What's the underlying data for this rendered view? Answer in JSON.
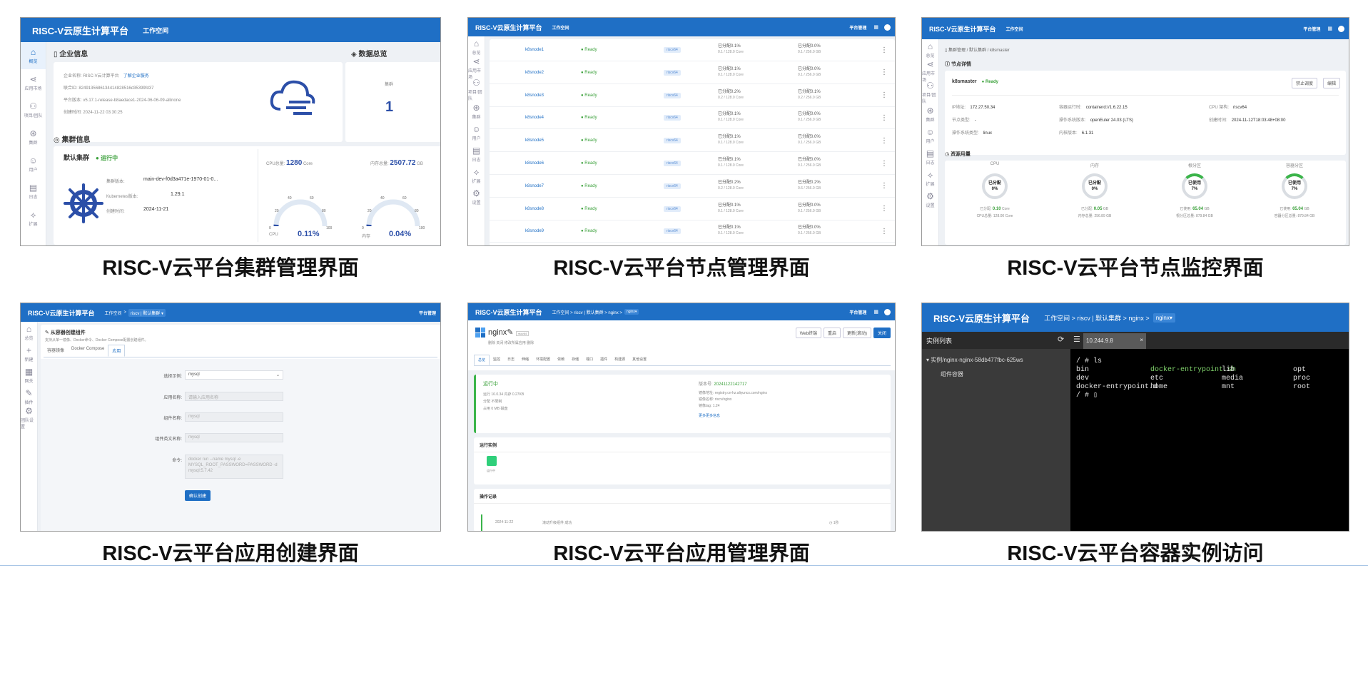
{
  "captions": [
    "RISC-V云平台集群管理界面",
    "RISC-V云平台节点管理界面",
    "RISC-V云平台节点监控界面",
    "RISC-V云平台应用创建界面",
    "RISC-V云平台应用管理界面",
    "RISC-V云平台容器实例访问"
  ],
  "colors": {
    "brand": "#1f6fc5",
    "status_green": "#3aa03a",
    "terminal_bg": "#000000"
  },
  "common": {
    "brand": "RISC-V云原生计算平台",
    "workspace": "工作空间",
    "platform_mgmt": "平台管理"
  },
  "p1": {
    "side": [
      {
        "icon": "home-icon",
        "label": "概览"
      },
      {
        "icon": "share-icon",
        "label": "应用市场"
      },
      {
        "icon": "team-icon",
        "label": "项目/团队"
      },
      {
        "icon": "cluster-icon",
        "label": "集群"
      },
      {
        "icon": "user-icon",
        "label": "用户"
      },
      {
        "icon": "log-icon",
        "label": "日志"
      },
      {
        "icon": "extend-icon",
        "label": "扩展"
      }
    ],
    "ent_title": "企业信息",
    "ent_name": "企业名称: RISC-V云计算平台",
    "ent_link": "了解企业服务",
    "ent_id": "联合ID: 8249135686134414828516d35399fd37",
    "ent_ver": "平台版本: v5.17.1-release-b8aedace1-2024-06-06-09-allinone",
    "ent_time": "创建时间: 2024-11-22 03:30:25",
    "data_title": "数据总览",
    "cluster_label": "集群",
    "cluster_count": "1",
    "cl_title": "集群信息",
    "cl_name": "默认集群",
    "cl_status": "运行中",
    "cl_ver_label": "集群版本:",
    "cl_ver": "main-dev-f0d3a471e-1970-01-0...",
    "k8s_label": "Kubernetes版本:",
    "k8s": "1.29.1",
    "created_label": "创建时间:",
    "created": "2024-11-21",
    "cpu_total_label": "CPU总量:",
    "cpu_total": "1280",
    "cpu_unit": "Core",
    "mem_total_label": "内存总量:",
    "mem_total": "2507.72",
    "mem_unit": "GB",
    "gauge_ticks": [
      "20",
      "40",
      "60",
      "80",
      "100",
      "0"
    ],
    "cpu_label": "CPU",
    "cpu_pct": "0.11%",
    "mem_label": "内存",
    "mem_pct": "0.04%",
    "cpu_level": 0.0011,
    "mem_level": 0.0004
  },
  "p2": {
    "side": [
      {
        "icon": "home-icon",
        "label": "总览"
      },
      {
        "icon": "share-icon",
        "label": "应用市场"
      },
      {
        "icon": "team-icon",
        "label": "项目/团队"
      },
      {
        "icon": "cluster-icon",
        "label": "集群"
      },
      {
        "icon": "user-icon",
        "label": "用户"
      },
      {
        "icon": "log-icon",
        "label": "日志"
      },
      {
        "icon": "extend-icon",
        "label": "扩展"
      },
      {
        "icon": "gear-icon",
        "label": "设置"
      }
    ],
    "rows": [
      {
        "name": "k8snode1",
        "status": "Ready",
        "tag": "riscv64",
        "cpu": "已分配0.1%",
        "cpu2": "0.1 / 128.0 Core",
        "mem": "已分配0.0%",
        "mem2": "0.1 / 256.0 GB"
      },
      {
        "name": "k8snode2",
        "status": "Ready",
        "tag": "riscv64",
        "cpu": "已分配0.1%",
        "cpu2": "0.1 / 128.0 Core",
        "mem": "已分配0.0%",
        "mem2": "0.1 / 256.0 GB"
      },
      {
        "name": "k8snode3",
        "status": "Ready",
        "tag": "riscv64",
        "cpu": "已分配0.2%",
        "cpu2": "0.2 / 128.0 Core",
        "mem": "已分配0.1%",
        "mem2": "0.2 / 256.0 GB"
      },
      {
        "name": "k8snode4",
        "status": "Ready",
        "tag": "riscv64",
        "cpu": "已分配0.1%",
        "cpu2": "0.1 / 128.0 Core",
        "mem": "已分配0.0%",
        "mem2": "0.1 / 256.0 GB"
      },
      {
        "name": "k8snode5",
        "status": "Ready",
        "tag": "riscv64",
        "cpu": "已分配0.1%",
        "cpu2": "0.1 / 128.0 Core",
        "mem": "已分配0.0%",
        "mem2": "0.1 / 256.0 GB"
      },
      {
        "name": "k8snode6",
        "status": "Ready",
        "tag": "riscv64",
        "cpu": "已分配0.1%",
        "cpu2": "0.1 / 128.0 Core",
        "mem": "已分配0.0%",
        "mem2": "0.1 / 256.0 GB"
      },
      {
        "name": "k8snode7",
        "status": "Ready",
        "tag": "riscv64",
        "cpu": "已分配0.2%",
        "cpu2": "0.2 / 128.0 Core",
        "mem": "已分配0.2%",
        "mem2": "0.6 / 256.0 GB"
      },
      {
        "name": "k8snode8",
        "status": "Ready",
        "tag": "riscv64",
        "cpu": "已分配0.1%",
        "cpu2": "0.1 / 128.0 Core",
        "mem": "已分配0.0%",
        "mem2": "0.1 / 256.0 GB"
      },
      {
        "name": "k8snode9",
        "status": "Ready",
        "tag": "riscv64",
        "cpu": "已分配0.1%",
        "cpu2": "0.1 / 128.0 Core",
        "mem": "已分配0.0%",
        "mem2": "0.1 / 256.0 GB"
      }
    ]
  },
  "p3": {
    "breadcrumb": "集群管理 / 默认集群 / k8smaster",
    "detail_title": "节点详情",
    "node": "k8smaster",
    "status": "Ready",
    "btn1": "禁止调度",
    "btn2": "编辑",
    "ip_label": "IP地址:",
    "ip": "172.27.50.34",
    "rt_label": "容器运行时:",
    "rt": "containerd://1.6.22.15",
    "arch_label": "CPU 架构:",
    "arch": "riscv64",
    "type_label": "节点类型:",
    "type": "-",
    "osimg_label": "操作系统版本:",
    "osimg": "openEuler 24.03 (LTS)",
    "ctime_label": "创建时间:",
    "ctime": "2024-11-12T18:03:48+08:00",
    "os_label": "操作系统类型:",
    "os": "linux",
    "kernel_label": "内核版本:",
    "kernel": "6.1.31",
    "usage_title": "资源用量",
    "rings": [
      {
        "title": "CPU",
        "state": "已分配",
        "pct": "0%",
        "l1": "已分配:",
        "v1": "0.10",
        "u1": "Core",
        "l2": "CPU总量:",
        "v2": "128.00 Core",
        "on": false
      },
      {
        "title": "内存",
        "state": "已分配",
        "pct": "0%",
        "l1": "已分配:",
        "v1": "0.05",
        "u1": "GB",
        "l2": "内存总量:",
        "v2": "256.89 GB",
        "on": false
      },
      {
        "title": "根分区",
        "state": "已使用",
        "pct": "7%",
        "l1": "已使用:",
        "v1": "65.04",
        "u1": "GB",
        "l2": "根分区总量:",
        "v2": "879.84 GB",
        "on": true
      },
      {
        "title": "容器分区",
        "state": "已使用",
        "pct": "7%",
        "l1": "已使用:",
        "v1": "65.04",
        "u1": "GB",
        "l2": "容器分区总量:",
        "v2": "879.84 GB",
        "on": true
      }
    ]
  },
  "p4": {
    "crumb": [
      "工作空间",
      ">",
      "riscv | 默认集群"
    ],
    "side": [
      {
        "icon": "home-icon",
        "label": "总览"
      },
      {
        "icon": "plus-icon",
        "label": "新建"
      },
      {
        "icon": "grid-icon",
        "label": "网关"
      },
      {
        "icon": "pen-icon",
        "label": "插件"
      },
      {
        "icon": "gear-icon",
        "label": "团队设置"
      }
    ],
    "title": "从容器创建组件",
    "subtitle": "支持从单一镜像、Docker命令、Docker Compose配置创建组件。",
    "tabs": [
      "容器镜像",
      "Docker Compose",
      "应用"
    ],
    "f1_label": "选择示例:",
    "f1": "mysql",
    "f2_label": "应用名称:",
    "f2": "请输入应用名称",
    "f3_label": "组件名称:",
    "f3": "mysql",
    "f4_label": "组件英文名称:",
    "f4": "mysql",
    "f5_label": "命令:",
    "f5": "docker run --name mysql -e MYSQL_ROOT_PASSWORD=PASSWORD -d mysql:5.7.42",
    "submit": "确认创建"
  },
  "p5": {
    "crumb": "工作空间 > riscv | 默认集群 > nginx >",
    "crumb_tag": "nginx",
    "app": "nginx",
    "app_tag": "riscv64",
    "sub": "删除   关闭   修改所属应用   删除",
    "btns": [
      "Web终端",
      "重启",
      "更新(滚动)",
      "关闭"
    ],
    "tabs": [
      "总览",
      "监控",
      "日志",
      "伸缩",
      "环境配置",
      "依赖",
      "存储",
      "端口",
      "插件",
      "构建源",
      "其他设置"
    ],
    "status": "运行中",
    "l1": "运行 16.0.34 内存 0.27KB",
    "l2": "分配 不限制",
    "l3": "占用 0     MB 磁盘",
    "ver_label": "版本号:",
    "ver": "20241122142717",
    "i1": "镜像地址: registry.cn-hz.aliyuncs.com/nginx",
    "i2": "镜像名称: riscv/nginx",
    "i3": "镜像tag: 1.24",
    "more": "更多更多信息",
    "inst_title": "运行实例",
    "inst_label": "运行中",
    "ops_title": "操作记录",
    "op_date": "2024-11-22",
    "op_text": "滚动升级组件 成功",
    "op_time": "1秒"
  },
  "p6": {
    "crumb": "工作空间 > riscv | 默认集群 > nginx >",
    "crumb_tag": "nginx",
    "list_title": "实例列表",
    "instance": "实例/nginx-nginx-58db477fbc-625ws",
    "container": "组件容器",
    "tab": "10.244.9.8",
    "term": [
      {
        "c": [
          "/ # ls",
          "",
          "",
          ""
        ]
      },
      {
        "c": [
          "bin",
          "docker-entrypoint.sh",
          "lib",
          "opt"
        ]
      },
      {
        "c": [
          "dev",
          "etc",
          "media",
          "proc"
        ]
      },
      {
        "c": [
          "docker-entrypoint.d",
          "home",
          "mnt",
          "root"
        ]
      },
      {
        "c": [
          "/ # ▯",
          "",
          "",
          ""
        ]
      }
    ]
  }
}
